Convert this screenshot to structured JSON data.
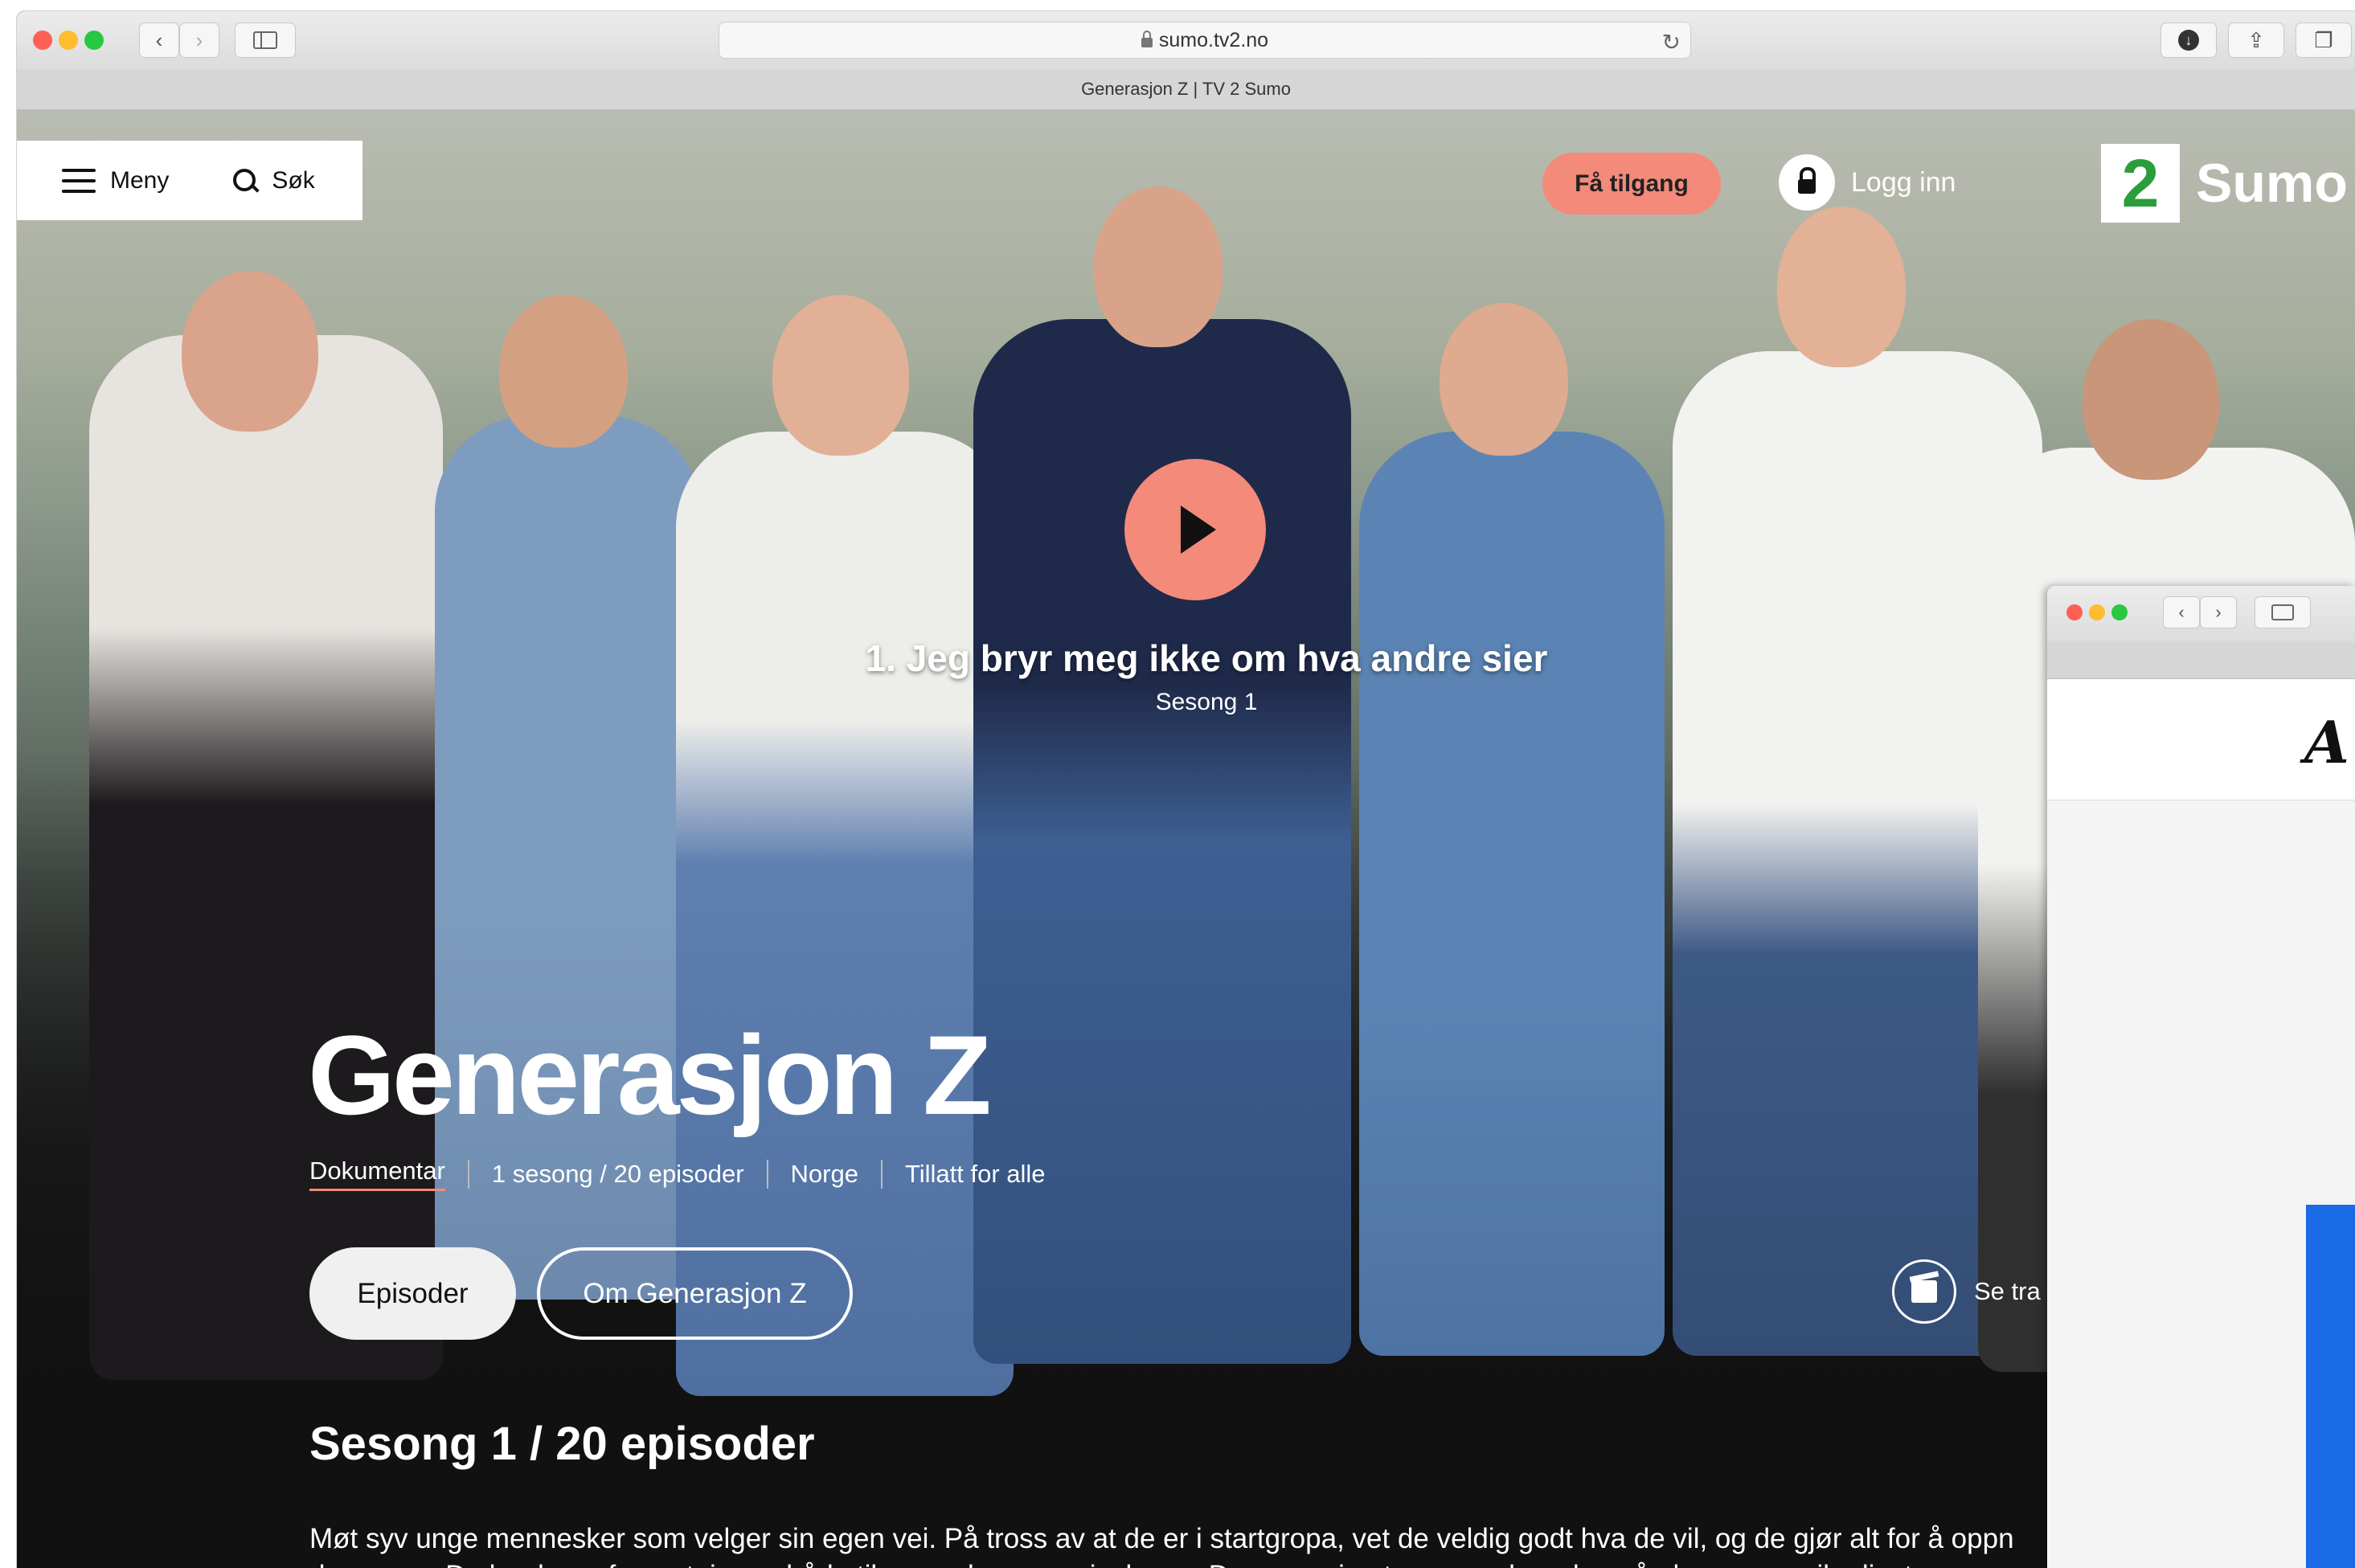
{
  "browser": {
    "url": "sumo.tv2.no",
    "tab_title": "Generasjon Z | TV 2 Sumo"
  },
  "nav": {
    "menu_label": "Meny",
    "search_label": "Søk",
    "access_label": "Få tilgang",
    "login_label": "Logg inn",
    "logo_number": "2",
    "logo_text": "Sumo"
  },
  "featured_episode": {
    "title": "1. Jeg bryr meg ikke om hva andre sier",
    "season": "Sesong 1"
  },
  "show": {
    "title": "Generasjon Z",
    "meta": [
      "Dokumentar",
      "1 sesong / 20 episoder",
      "Norge",
      "Tillatt for alle"
    ],
    "episodes_button": "Episoder",
    "about_button": "Om Generasjon Z",
    "trailer_label": "Se tra",
    "season_heading": "Sesong 1 / 20 episoder",
    "description_line1": "Møt syv unge mennesker som velger sin egen vei. På tross av at de er i startgropa, vet de veldig godt hva de vil, og de gjør alt for å oppn",
    "description_line2": "drømmen. De har høye forventninger, både til seg selv og omgivelsene. Denne serien tar unges hverdag på alvor, og speiler livet som"
  },
  "second_window": {
    "logo_glyph": "A"
  },
  "colors": {
    "accent": "#f48a7a",
    "page_bg": "#111111",
    "logo_blue": "#1a6ae6"
  }
}
